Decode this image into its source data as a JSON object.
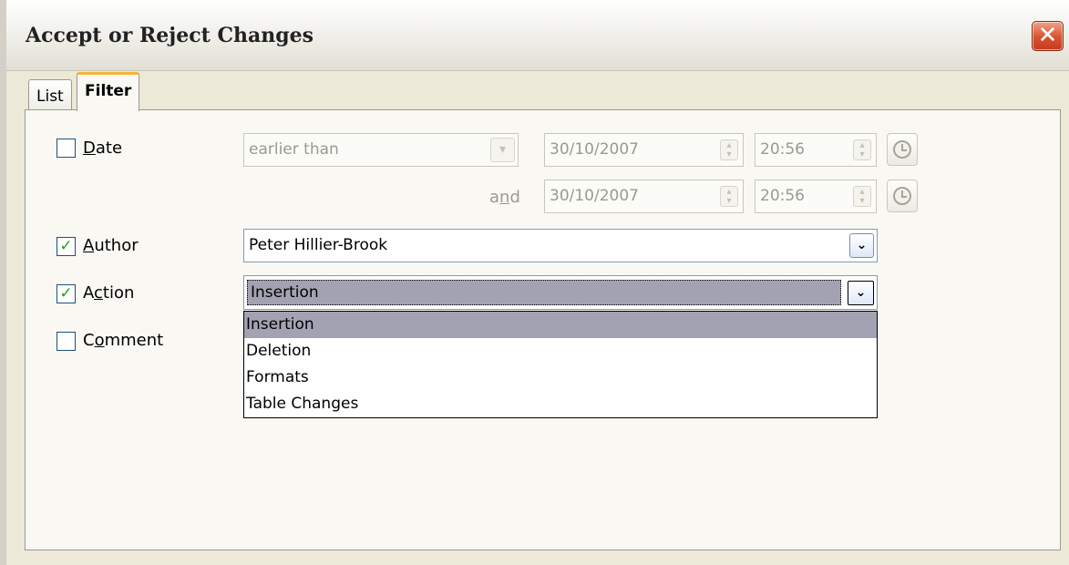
{
  "window": {
    "title": "Accept or Reject Changes",
    "close_label": "✕"
  },
  "tabs": [
    {
      "label": "List",
      "selected": false
    },
    {
      "label": "Filter",
      "selected": true
    }
  ],
  "date": {
    "checked": false,
    "label_mnemonic": "D",
    "label_rest": "ate",
    "condition": "earlier than",
    "and_label_pre": "a",
    "and_label_mnemonic": "n",
    "and_label_post": "d",
    "from_date": "30/10/2007",
    "from_time": "20:56",
    "to_date": "30/10/2007",
    "to_time": "20:56"
  },
  "author": {
    "checked": true,
    "label_mnemonic": "A",
    "label_rest": "uthor",
    "value": "Peter Hillier-Brook"
  },
  "action": {
    "checked": true,
    "label_pre": "A",
    "label_mnemonic": "c",
    "label_post": "tion",
    "value": "Insertion",
    "options": [
      "Insertion",
      "Deletion",
      "Formats",
      "Table Changes"
    ]
  },
  "comment": {
    "checked": false,
    "label_pre": "C",
    "label_mnemonic": "o",
    "label_post": "mment"
  },
  "icons": {
    "checkmark": "✓",
    "chevron": "❯"
  }
}
